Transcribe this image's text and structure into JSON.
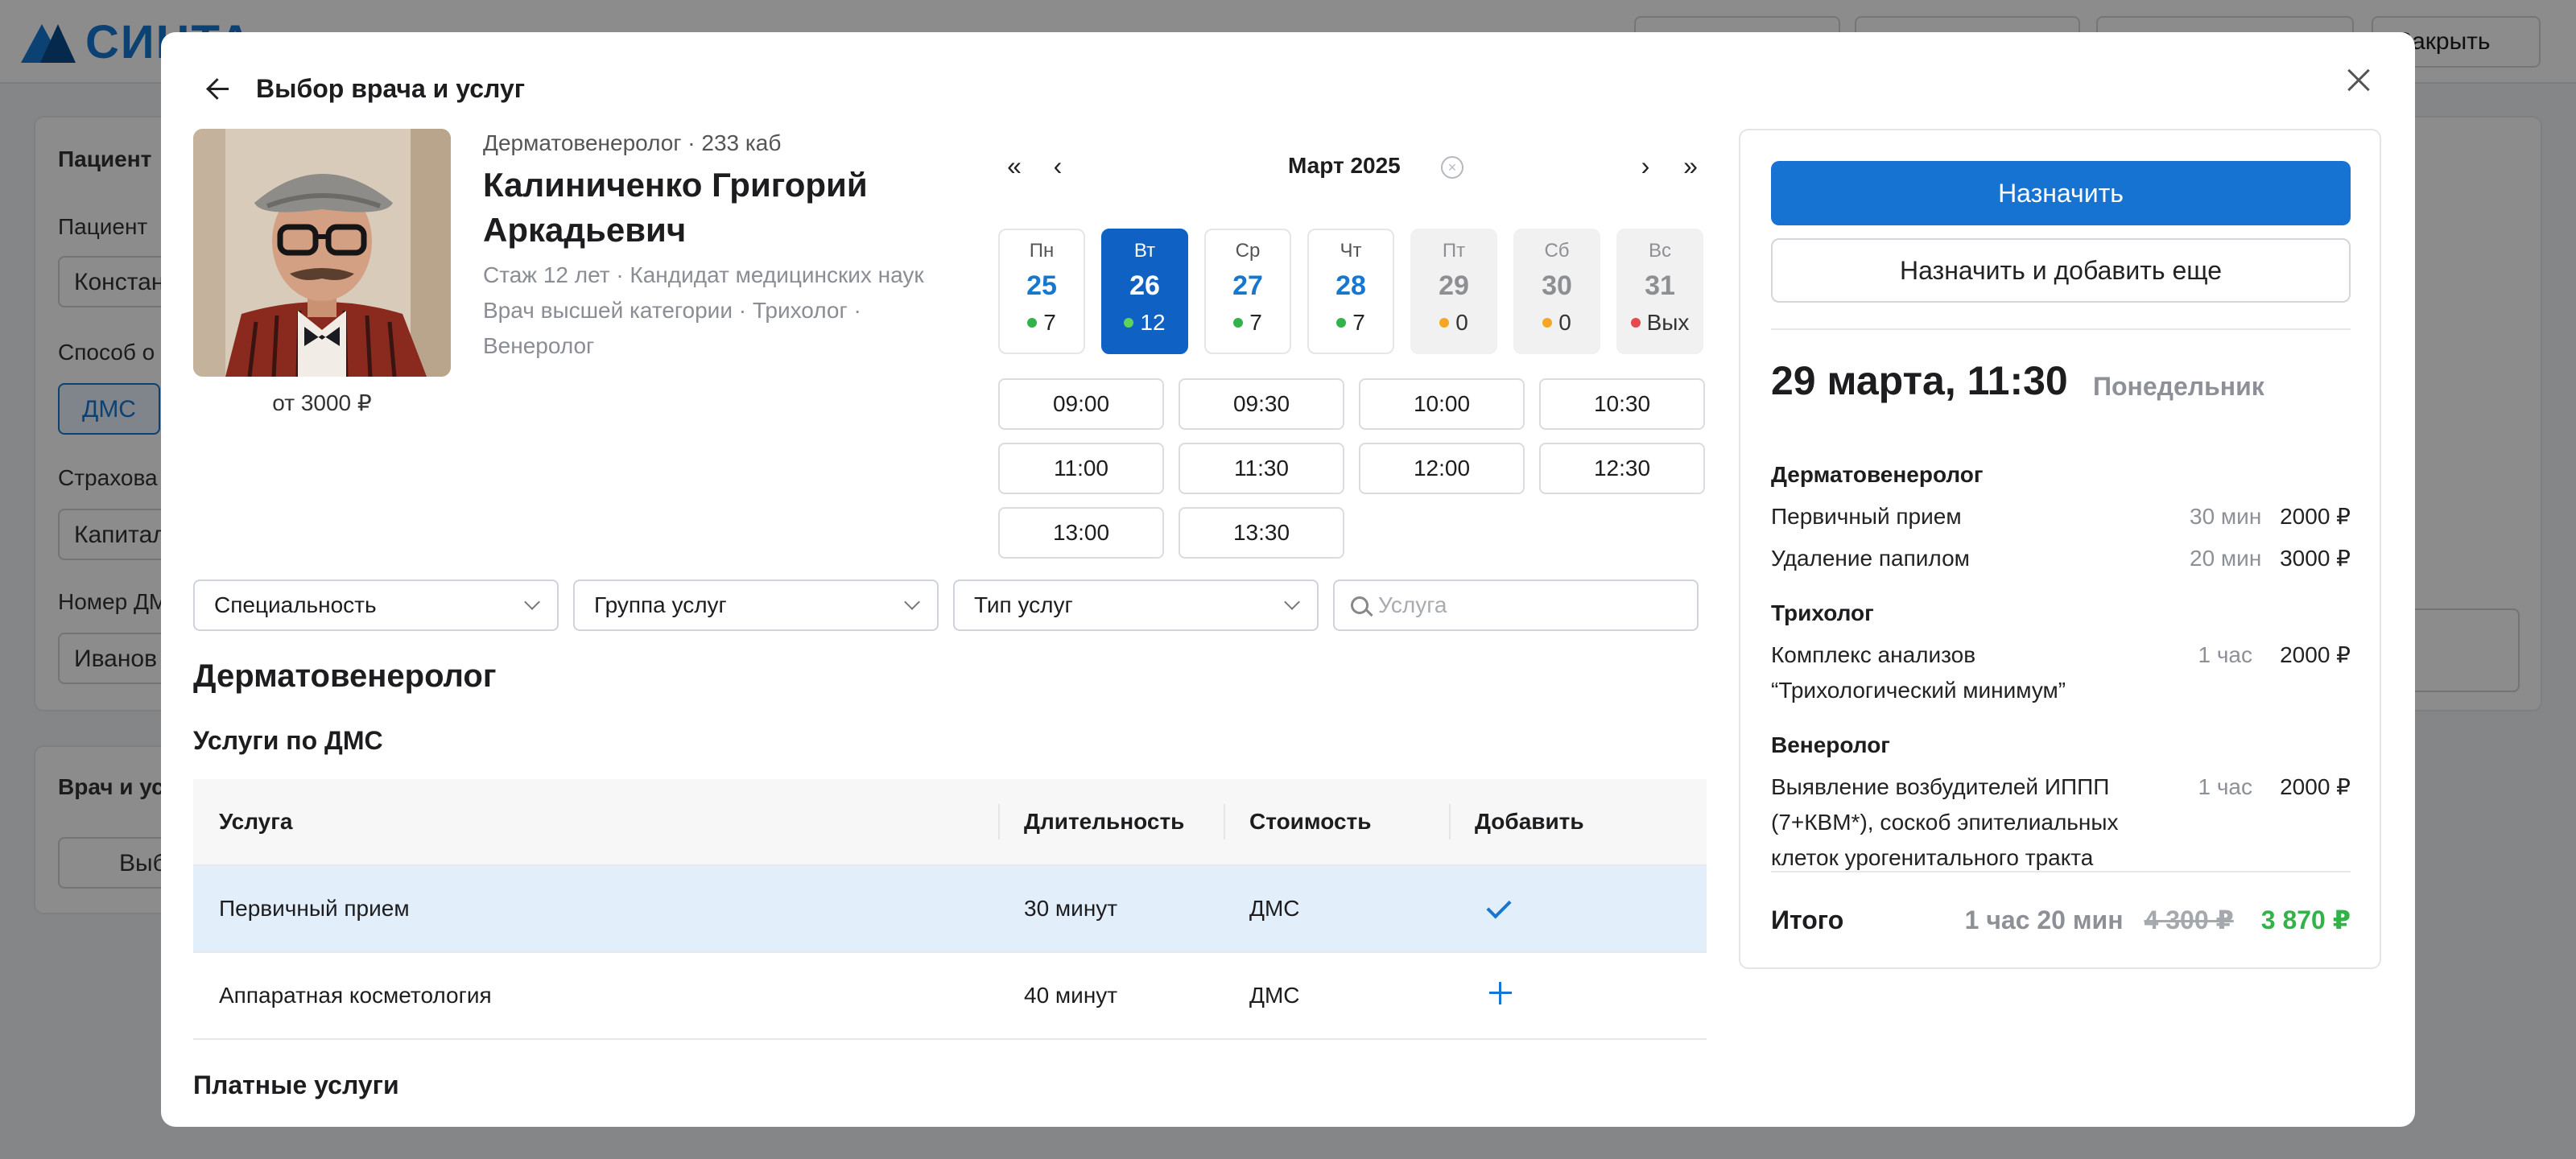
{
  "background": {
    "logo_text": "СИНТА",
    "close_label": "Закрыть",
    "patient_section": "Пациент",
    "patient_label": "Пациент",
    "patient_value": "Констан",
    "payment_label": "Способ о",
    "payment_tag": "ДМС",
    "insurer_label": "Страхова",
    "insurer_value": "Капитал",
    "dms_label": "Номер ДМ",
    "dms_value": "Иванов",
    "doctor_section": "Врач и ус",
    "choose_label": "Выб"
  },
  "modal": {
    "title": "Выбор врача и услуг"
  },
  "doctor": {
    "specialty_room": "Дерматовенеролог · 233 каб",
    "name": "Калиниченко Григорий Аркадьевич",
    "meta_line1": "Стаж 12 лет · Кандидат медицинских наук",
    "meta_line2": "Врач высшей категории · Трихолог ·",
    "meta_line3": "Венеролог",
    "price_from": "от 3000 ₽"
  },
  "calendar": {
    "month": "Март 2025",
    "days": [
      {
        "name": "Пн",
        "date": "25",
        "slots": "7",
        "status_color": "#34b24a",
        "state": "normal"
      },
      {
        "name": "Вт",
        "date": "26",
        "slots": "12",
        "status_color": "#5fd35c",
        "state": "selected"
      },
      {
        "name": "Ср",
        "date": "27",
        "slots": "7",
        "status_color": "#34b24a",
        "state": "normal"
      },
      {
        "name": "Чт",
        "date": "28",
        "slots": "7",
        "status_color": "#34b24a",
        "state": "normal"
      },
      {
        "name": "Пт",
        "date": "29",
        "slots": "0",
        "status_color": "#f5a623",
        "state": "off"
      },
      {
        "name": "Сб",
        "date": "30",
        "slots": "0",
        "status_color": "#f5a623",
        "state": "off"
      },
      {
        "name": "Вс",
        "date": "31",
        "slots": "Вых",
        "status_color": "#e5484d",
        "state": "off"
      }
    ],
    "times": [
      "09:00",
      "09:30",
      "10:00",
      "10:30",
      "11:00",
      "11:30",
      "12:00",
      "12:30",
      "13:00",
      "13:30"
    ]
  },
  "filters": {
    "specialty": "Специальность",
    "service_group": "Группа услуг",
    "service_type": "Тип услуг",
    "search_placeholder": "Услуга"
  },
  "services": {
    "section_title": "Дерматовенеролог",
    "dms_title": "Услуги по ДМС",
    "paid_title": "Платные услуги",
    "columns": {
      "service": "Услуга",
      "duration": "Длительность",
      "cost": "Стоимость",
      "add": "Добавить"
    },
    "rows": [
      {
        "service": "Первичный прием",
        "duration": "30 минут",
        "cost": "ДМС",
        "added": true
      },
      {
        "service": "Аппаратная косметология",
        "duration": "40 минут",
        "cost": "ДМС",
        "added": false
      }
    ]
  },
  "summary": {
    "assign_label": "Назначить",
    "assign_more_label": "Назначить и добавить еще",
    "datetime": "29 марта, 11:30",
    "weekday": "Понедельник",
    "groups": [
      {
        "title": "Дерматовенеролог",
        "items": [
          {
            "name": "Первичный прием",
            "duration": "30 мин",
            "price": "2000 ₽"
          },
          {
            "name": "Удаление папилом",
            "duration": "20 мин",
            "price": "3000 ₽"
          }
        ]
      },
      {
        "title": "Трихолог",
        "items": [
          {
            "name": "Комплекс анализов “Трихологический минимум”",
            "duration": "1 час",
            "price": "2000 ₽"
          }
        ]
      },
      {
        "title": "Венеролог",
        "items": [
          {
            "name": "Выявление возбудителей ИППП (7+КВМ*), соскоб эпителиальных клеток урогенитального тракта",
            "duration": "1 час",
            "price": "2000 ₽"
          }
        ]
      }
    ],
    "total_label": "Итого",
    "total_duration": "1 час 20 мин",
    "total_old": "4 300 ₽",
    "total_new": "3 870 ₽"
  }
}
